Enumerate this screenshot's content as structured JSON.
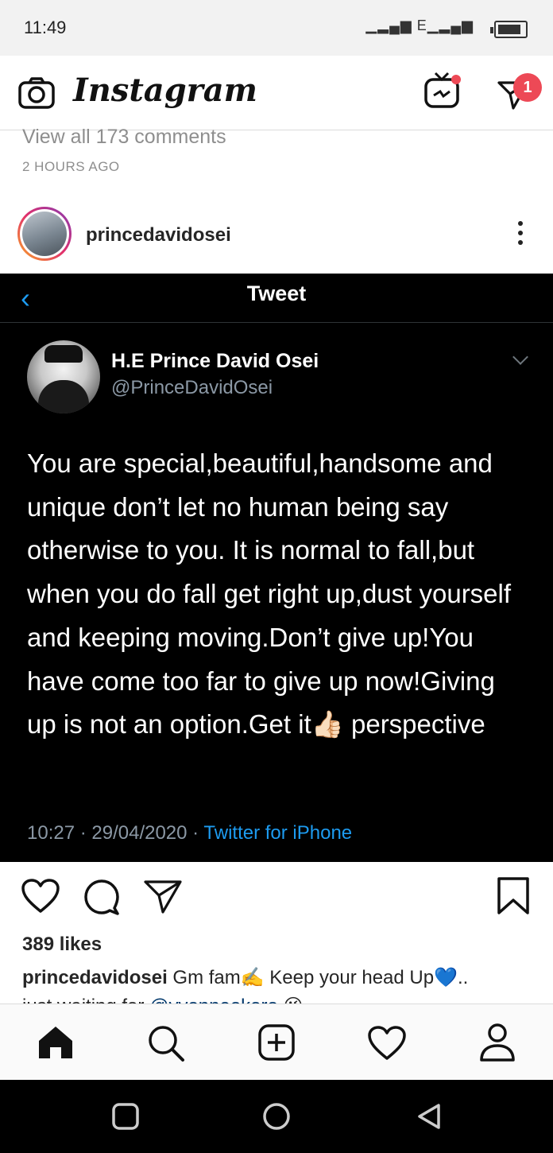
{
  "status_bar": {
    "time": "11:49",
    "signal": "E"
  },
  "header": {
    "title": "Instagram",
    "dm_badge": "1"
  },
  "post": {
    "view_all_comments": "View all 173 comments",
    "time_ago": "2 HOURS AGO",
    "username": "princedavidosei",
    "likes": "389 likes",
    "caption_username": "princedavidosei",
    "caption_text": " Gm fam✍️ Keep your head Up💙..",
    "caption_line2_prefix": "just waiting for ",
    "caption_mention": "@yvonneokoro",
    "caption_emoji": " 😉"
  },
  "tweet": {
    "bar_title": "Tweet",
    "author_name": "H.E Prince David Osei",
    "author_handle": "@PrinceDavidOsei",
    "text": "You are special,beautiful,handsome and unique don’t let no human being say otherwise to you. It is normal to fall,but when you do fall get right up,dust yourself and keeping moving.Don’t give up!You have come too far to give up now!Giving up is not an option.Get it👍🏻 perspective",
    "time": "10:27 · 29/04/2020 · ",
    "source": "Twitter for iPhone"
  },
  "colors": {
    "twitter_blue": "#1d9bf0",
    "badge_red": "#ed4956",
    "tweet_bg": "#000000"
  },
  "icons": [
    "camera-icon",
    "igtv-icon",
    "direct-icon",
    "heart-icon",
    "comment-icon",
    "share-icon",
    "bookmark-icon",
    "home-icon",
    "search-icon",
    "add-post-icon",
    "activity-icon",
    "profile-icon",
    "square-nav-icon",
    "circle-nav-icon",
    "back-triangle-icon"
  ]
}
